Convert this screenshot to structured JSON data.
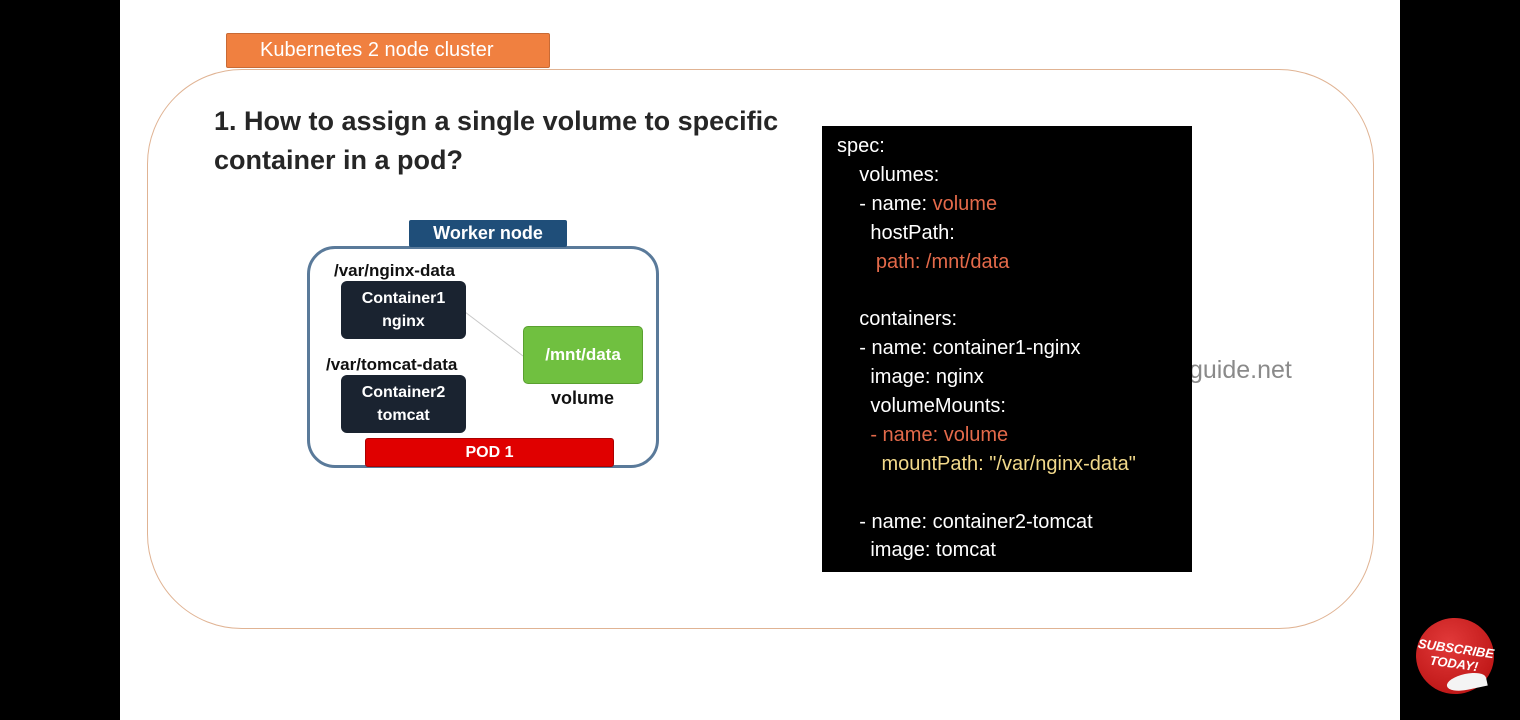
{
  "tag": {
    "label": "Kubernetes 2 node cluster"
  },
  "question": {
    "line1": "1. How to assign a single volume to specific",
    "line2": "container in a pod?"
  },
  "diagram": {
    "node_label": "Worker node",
    "path1": "/var/nginx-data",
    "container1": {
      "line1": "Container1",
      "line2": "nginx"
    },
    "path2": "/var/tomcat-data",
    "container2": {
      "line1": "Container2",
      "line2": "tomcat"
    },
    "volume_box": "/mnt/data",
    "volume_label": "volume",
    "pod": "POD 1"
  },
  "watermark": "guide.net",
  "code": {
    "l1": "spec:",
    "l2": "    volumes:",
    "l3a": "    - name: ",
    "l3b": "volume",
    "l4": "      hostPath:",
    "l5": "       path: /mnt/data",
    "l6": "",
    "l7": "    containers:",
    "l8": "    - name: container1-nginx",
    "l9": "      image: nginx",
    "l10": "      volumeMounts:",
    "l11": "      - name: volume",
    "l12": "        mountPath: \"/var/nginx-data\"",
    "l13": "",
    "l14": "    - name: container2-tomcat",
    "l15": "      image: tomcat"
  },
  "subscribe": {
    "line1": "SUBSCRIBE",
    "line2": "TODAY!"
  },
  "colors": {
    "tag": "#f08040",
    "node": "#1f4e79",
    "volume": "#70c040",
    "pod": "#e00000",
    "code_accent": "#e46a4a",
    "code_yellow": "#f2d98a"
  }
}
